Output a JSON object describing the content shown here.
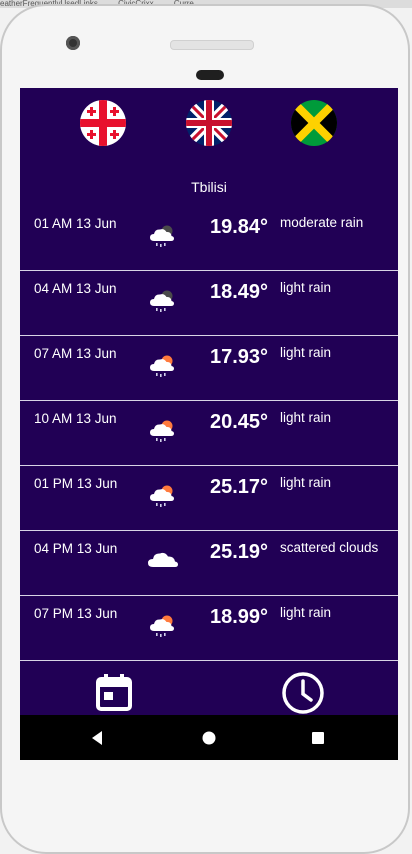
{
  "browser_tabs": [
    "eatherFrequentlyUsedLinks",
    "CivicCrixx",
    "Curre"
  ],
  "app": {
    "city": "Tbilisi",
    "flags": [
      {
        "icon": "georgia-flag-icon"
      },
      {
        "icon": "uk-flag-icon"
      },
      {
        "icon": "jamaica-flag-icon"
      }
    ],
    "forecast": [
      {
        "time": "01 AM 13 Jun",
        "temp": "19.84°",
        "desc": "moderate rain",
        "icon": "night-rain-icon"
      },
      {
        "time": "04 AM 13 Jun",
        "temp": "18.49°",
        "desc": "light rain",
        "icon": "night-rain-icon"
      },
      {
        "time": "07 AM 13 Jun",
        "temp": "17.93°",
        "desc": "light rain",
        "icon": "day-rain-icon"
      },
      {
        "time": "10 AM 13 Jun",
        "temp": "20.45°",
        "desc": "light rain",
        "icon": "day-rain-icon"
      },
      {
        "time": "01 PM 13 Jun",
        "temp": "25.17°",
        "desc": "light rain",
        "icon": "day-rain-icon"
      },
      {
        "time": "04 PM 13 Jun",
        "temp": "25.19°",
        "desc": "scattered clouds",
        "icon": "cloud-icon"
      },
      {
        "time": "07 PM 13 Jun",
        "temp": "18.99°",
        "desc": "light rain",
        "icon": "day-rain-icon"
      }
    ],
    "tabs": [
      {
        "icon": "calendar-icon"
      },
      {
        "icon": "clock-icon"
      }
    ]
  },
  "colors": {
    "app_background": "#210055",
    "divider": "#d8d4e6",
    "sun": "#ff7a3d"
  }
}
